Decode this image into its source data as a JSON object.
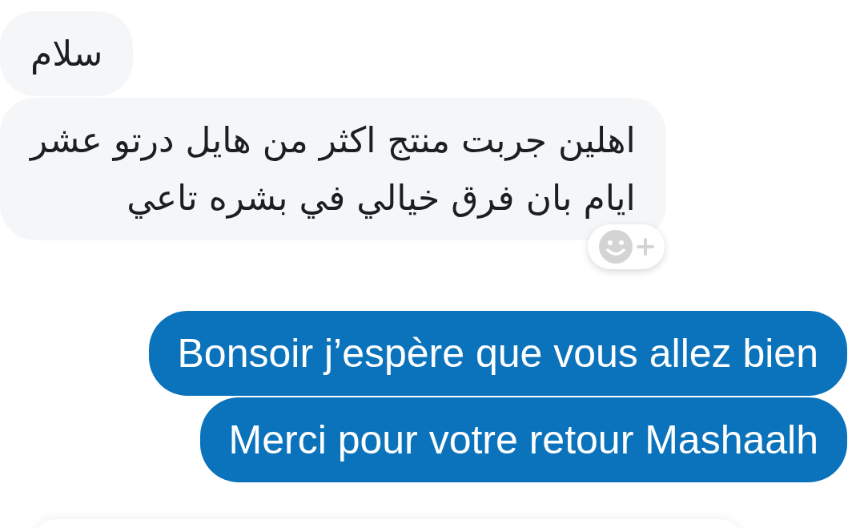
{
  "messages": [
    {
      "kind": "incoming",
      "text": "سلام",
      "reaction_button": false
    },
    {
      "kind": "incoming",
      "text": "اهلين جربت منتج اكثر من هايل درتو عشر\nايام بان فرق خيالي في بشره تاعي",
      "reaction_button": true
    },
    {
      "kind": "outgoing",
      "text": "Bonsoir j’espère que vous allez bien",
      "reaction_button": false
    },
    {
      "kind": "outgoing",
      "text": "Merci pour votre retour Mashaalh",
      "reaction_button": false
    }
  ]
}
